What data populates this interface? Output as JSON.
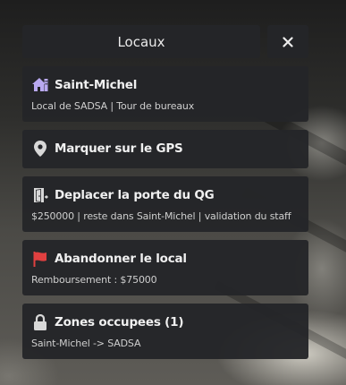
{
  "header": {
    "title": "Locaux",
    "close_icon": "close-icon"
  },
  "items": [
    {
      "label": "Saint-Michel",
      "subtitle": "Local de SADSA | Tour de bureaux",
      "icon": "home-icon",
      "icon_color": "#b9a9f0"
    },
    {
      "label": "Marquer sur le GPS",
      "icon": "map-pin-icon",
      "icon_color": "#d8d8d8"
    },
    {
      "label": "Deplacer la porte du QG",
      "subtitle": "$250000 | reste dans Saint-Michel | validation du staff",
      "icon": "door-icon",
      "icon_color": "#d8d8d8"
    },
    {
      "label": "Abandonner le local",
      "subtitle": "Remboursement : $75000",
      "icon": "flag-icon",
      "icon_color": "#e04040"
    },
    {
      "label": "Zones occupees (1)",
      "subtitle": "Saint-Michel -> SADSA",
      "icon": "lock-icon",
      "icon_color": "#d8d8d8"
    }
  ]
}
